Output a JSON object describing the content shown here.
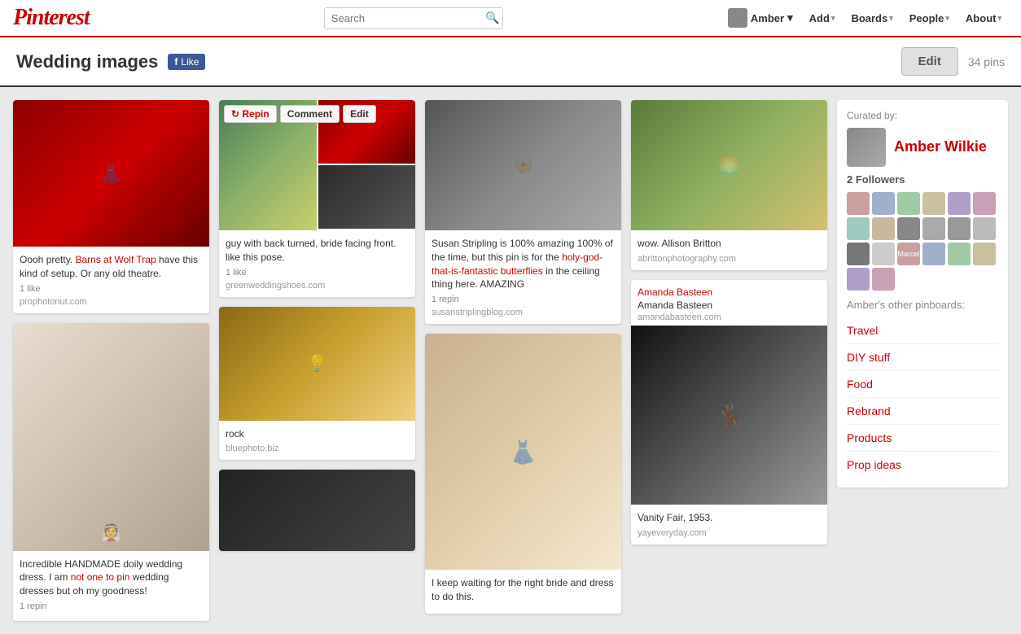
{
  "header": {
    "logo": "Pinterest",
    "search_placeholder": "Search",
    "user_name": "Amber",
    "user_caret": "▾",
    "nav_items": [
      {
        "id": "add",
        "label": "Add",
        "caret": "▾"
      },
      {
        "id": "boards",
        "label": "Boards",
        "caret": "▾"
      },
      {
        "id": "people",
        "label": "People",
        "caret": "▾"
      },
      {
        "id": "about",
        "label": "About",
        "caret": "▾"
      }
    ]
  },
  "sub_header": {
    "title": "Wedding images",
    "fb_like": "Like",
    "edit_btn": "Edit",
    "pins_count": "34 pins"
  },
  "pins": {
    "col1": [
      {
        "id": "p1",
        "img_class": "img-dark-red aspect-tall",
        "description": "Oooh pretty. Barns at Wolf Trap have this kind of setup. Or any old theatre.",
        "likes": "1 like",
        "source": "prophotonut.com"
      },
      {
        "id": "p2",
        "img_class": "img-bride-bouquet aspect-xxl",
        "description": "Incredible HANDMADE doily wedding dress. I am not one to pin wedding dresses but oh my goodness!",
        "likes": "1 repin",
        "source": ""
      }
    ],
    "col2": [
      {
        "id": "p3",
        "img_class": "img-garden aspect-medium",
        "img2_class": "img-dark-red aspect-short",
        "split": true,
        "description": "guy with back turned, bride facing front. like this pose.",
        "likes": "1 like",
        "source": "greenweddingshoes.com",
        "actions": [
          "Repin",
          "Comment",
          "Edit"
        ]
      },
      {
        "id": "p4",
        "img_class": "img-barn aspect-medium",
        "description": "rock",
        "likes": "",
        "source": "bluephoto.biz"
      },
      {
        "id": "p5",
        "img_class": "img-dark-bottom aspect-medium",
        "description": "",
        "likes": "",
        "source": ""
      }
    ],
    "col3": [
      {
        "id": "p6",
        "img_class": "img-butterflies aspect-tall",
        "description": "Susan Stripling is 100% amazing 100% of the time, but this pin is for the holy-god-that-is-fantastic butterflies in the ceiling thing here. AMAZING",
        "likes": "1 repin",
        "source": "susanstriplingblog.com"
      },
      {
        "id": "p7",
        "img_class": "img-sepia-bride aspect-xxl",
        "description": "I keep waiting for the right bride and dress to do this.",
        "likes": "",
        "source": ""
      }
    ],
    "col4": [
      {
        "id": "p8",
        "img_class": "img-path aspect-tall",
        "description": "wow. Allison Britton",
        "likes": "",
        "source": "abrittonphotography.com"
      },
      {
        "id": "p9",
        "author": "Amanda Basteen",
        "author_name": "Amanda Basteen",
        "author_url": "amandabasteen.com",
        "img_class": "img-bw-dance aspect-xtall",
        "description": "Vanity Fair, 1953.",
        "likes": "",
        "source": "yayeveryday.com"
      }
    ]
  },
  "sidebar": {
    "curated_label": "Curated by:",
    "curator_name": "Amber Wilkie",
    "followers_label": "2 Followers",
    "pinboards_label": "Amber's other pinboards:",
    "pinboards": [
      {
        "id": "travel",
        "name": "Travel"
      },
      {
        "id": "diy",
        "name": "DIY stuff"
      },
      {
        "id": "food",
        "name": "Food"
      },
      {
        "id": "rebrand",
        "name": "Rebrand"
      },
      {
        "id": "products",
        "name": "Products"
      },
      {
        "id": "prop-ideas",
        "name": "Prop ideas"
      }
    ],
    "follower_colors": [
      "av1",
      "av2",
      "av3",
      "av4",
      "av5",
      "av6",
      "av7",
      "av8",
      "av9",
      "av10",
      "av11",
      "av12",
      "av13",
      "av14",
      "av1",
      "av2",
      "av3",
      "av4",
      "av5",
      "av2"
    ]
  }
}
